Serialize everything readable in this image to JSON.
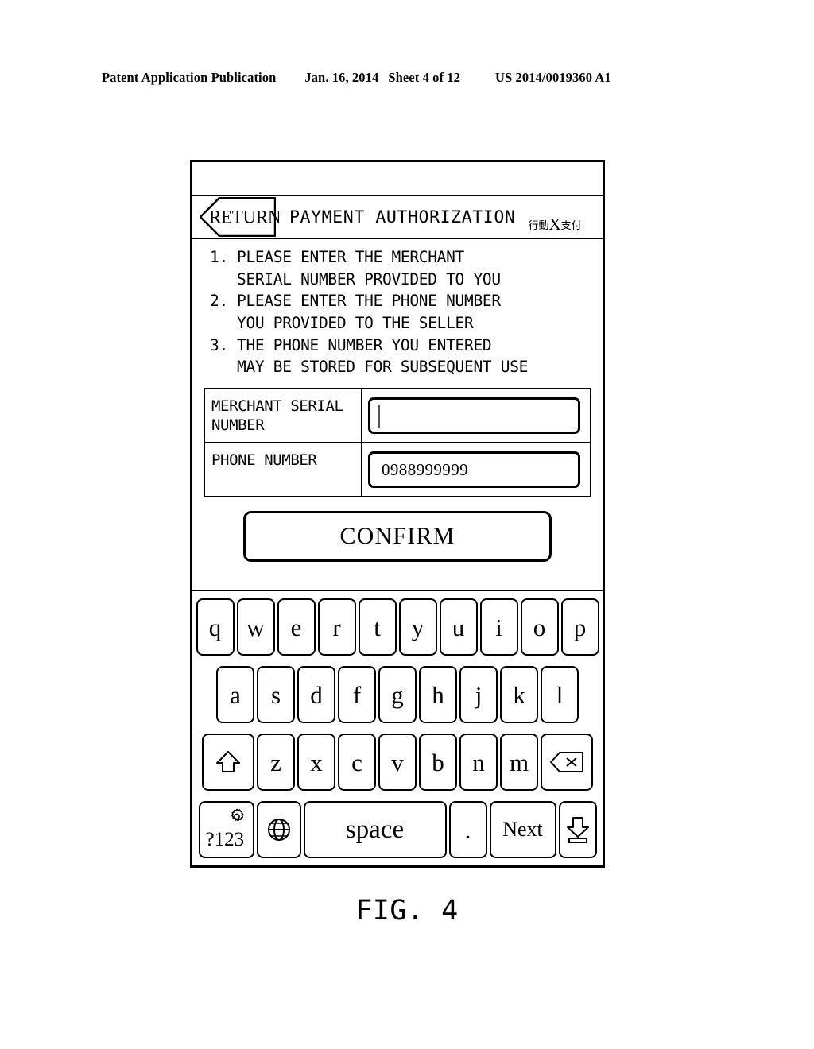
{
  "page_header": {
    "publication": "Patent Application Publication",
    "date": "Jan. 16, 2014",
    "sheet": "Sheet 4 of 12",
    "doc_number": "US 2014/0019360 A1"
  },
  "figure": {
    "caption": "FIG. 4"
  },
  "screen": {
    "titlebar": {
      "return_label": "RETURN",
      "title": "PAYMENT AUTHORIZATION",
      "brand_prefix": "行動",
      "brand_mark": "X",
      "brand_suffix": "支付"
    },
    "instructions": [
      {
        "number": "1.",
        "line1": "PLEASE ENTER THE MERCHANT",
        "line2": "SERIAL NUMBER PROVIDED TO YOU"
      },
      {
        "number": "2.",
        "line1": "PLEASE ENTER THE PHONE NUMBER",
        "line2": "YOU PROVIDED TO THE SELLER"
      },
      {
        "number": "3.",
        "line1": "THE PHONE NUMBER YOU ENTERED",
        "line2": "MAY BE STORED FOR SUBSEQUENT USE"
      }
    ],
    "form": {
      "merchant_serial": {
        "label_line1": "MERCHANT SERIAL",
        "label_line2": "NUMBER",
        "value": "",
        "focused": true
      },
      "phone_number": {
        "label_line1": "PHONE NUMBER",
        "label_line2": "",
        "value": "0988999999",
        "focused": false
      }
    },
    "confirm_button": "CONFIRM"
  },
  "keyboard": {
    "row1": [
      "q",
      "w",
      "e",
      "r",
      "t",
      "y",
      "u",
      "i",
      "o",
      "p"
    ],
    "row2": [
      "a",
      "s",
      "d",
      "f",
      "g",
      "h",
      "j",
      "k",
      "l"
    ],
    "row3_letters": [
      "z",
      "x",
      "c",
      "v",
      "b",
      "n",
      "m"
    ],
    "row3_shift_icon": "shift-icon",
    "row3_backspace_icon": "backspace-icon",
    "row4": {
      "symbols_label": "?123",
      "symbols_gear_icon": "gear-icon",
      "globe_icon": "globe-icon",
      "space_label": "space",
      "period_label": ".",
      "next_label": "Next",
      "hide_keyboard_icon": "hide-keyboard-icon"
    }
  },
  "colors": {
    "ink": "#000000",
    "paper": "#ffffff",
    "caret": "#555555"
  }
}
